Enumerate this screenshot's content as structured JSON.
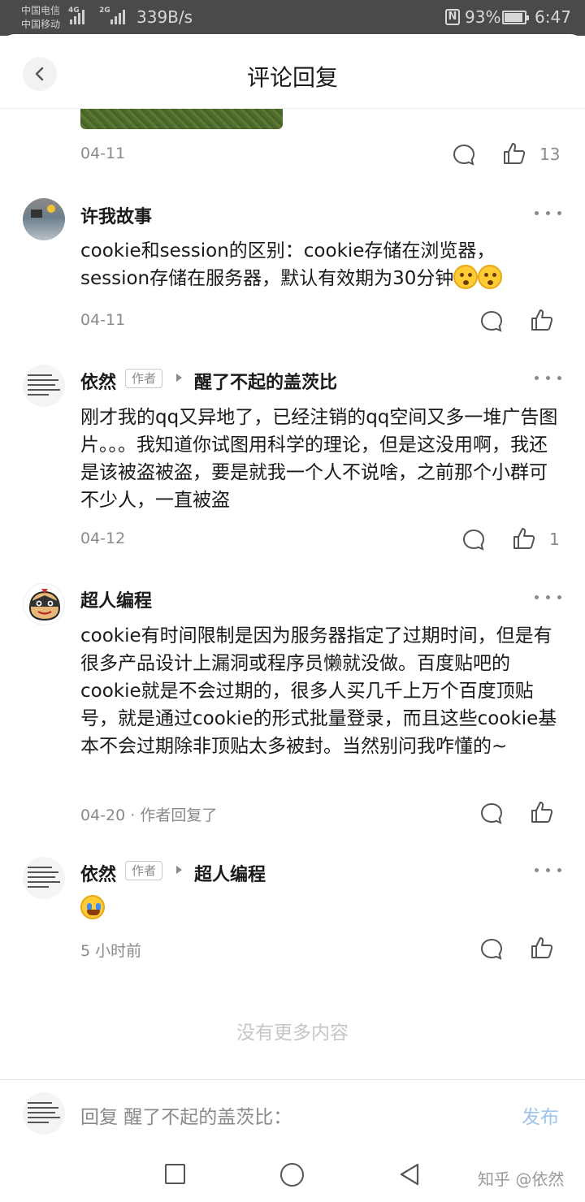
{
  "status_bar": {
    "carrier1": "中国电信",
    "carrier2": "中国移动",
    "net1": "4G",
    "net2": "2G",
    "speed": "339B/s",
    "nfc": "N",
    "battery_pct": "93%",
    "battery_level": 0.93,
    "time": "6:47"
  },
  "header": {
    "title": "评论回复"
  },
  "top_item": {
    "date": "04-11",
    "like_count": "13"
  },
  "comments": [
    {
      "author": "许我故事",
      "text": "cookie和session的区别：cookie存储在浏览器，session存储在服务器，默认有效期为30分钟",
      "emojis": [
        "shocked-emoji",
        "shocked-emoji"
      ],
      "date": "04-11",
      "like_count": ""
    },
    {
      "author": "依然",
      "author_tag": "作者",
      "reply_to": "醒了不起的盖茨比",
      "text": "刚才我的qq又异地了，已经注销的qq空间又多一堆广告图片。。。我知道你试图用科学的理论，但是这没用啊，我还是该被盗被盗，要是就我一个人不说啥，之前那个小群可不少人，一直被盗",
      "date": "04-12",
      "like_count": "1"
    },
    {
      "author": "超人编程",
      "text": "cookie有时间限制是因为服务器指定了过期时间，但是有很多产品设计上漏洞或程序员懒就没做。百度贴吧的cookie就是不会过期的，很多人买几千上万个百度顶贴号，就是通过cookie的形式批量登录，而且这些cookie基本不会过期除非顶贴太多被封。当然别问我咋懂的~",
      "date": "04-20 · 作者回复了",
      "like_count": ""
    },
    {
      "author": "依然",
      "author_tag": "作者",
      "reply_to": "超人编程",
      "emojis": [
        "crying-laughing-emoji"
      ],
      "date": "5 小时前",
      "like_count": ""
    }
  ],
  "footer": {
    "no_more": "没有更多内容",
    "composer_placeholder": "回复 醒了不起的盖茨比：",
    "publish": "发布",
    "watermark": "知乎 @依然"
  },
  "colors": {
    "status_bar_bg": "#4a4a4a",
    "publish_accent": "#9dc6ec",
    "secondary_text": "#8a8a8a"
  }
}
